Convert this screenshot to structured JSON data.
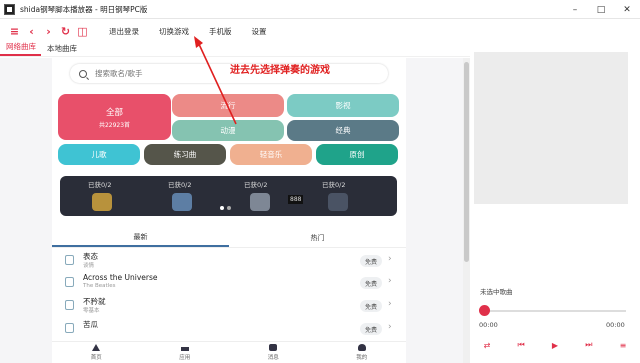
{
  "app": {
    "title": "shida钢琴脚本播放器 - 明日钢琴PC版"
  },
  "toolbar": {
    "icons": [
      "menu-icon",
      "back-icon",
      "forward-icon",
      "refresh-icon",
      "headset-icon"
    ],
    "menu": [
      "退出登录",
      "切换游戏",
      "手机版",
      "设置"
    ]
  },
  "tabs": [
    "网络曲库",
    "本地曲库"
  ],
  "search": {
    "placeholder": "搜索歌名/歌手"
  },
  "categories": {
    "all": {
      "label": "全部",
      "sub": "共22923首"
    },
    "pop": "流行",
    "film": "影视",
    "anime": "动漫",
    "classic": "经典",
    "kids": "儿歌",
    "etude": "练习曲",
    "light": "轻音乐",
    "orig": "原创"
  },
  "banner": {
    "badges": [
      "已获0/2",
      "已获0/2",
      "已获0/2",
      "已获0/2"
    ],
    "num": "888"
  },
  "list_tabs": [
    "最新",
    "热门"
  ],
  "songs": [
    {
      "title": "表态",
      "artist": "谈情",
      "price": "免费"
    },
    {
      "title": "Across the Universe",
      "artist": "The Beatles",
      "price": "免费"
    },
    {
      "title": "不矜就",
      "artist": "零基本",
      "price": "免费"
    },
    {
      "title": "苦瓜",
      "artist": "",
      "price": "免费"
    }
  ],
  "bottom_nav": [
    "首页",
    "应用",
    "消息",
    "我的"
  ],
  "annotation": "进去先选择弹奏的游戏",
  "player": {
    "status": "未选中歌曲",
    "time_current": "00:00",
    "time_total": "00:00",
    "progress": 0
  },
  "colors": {
    "accent": "#e0304a",
    "annotation": "#e02020"
  }
}
